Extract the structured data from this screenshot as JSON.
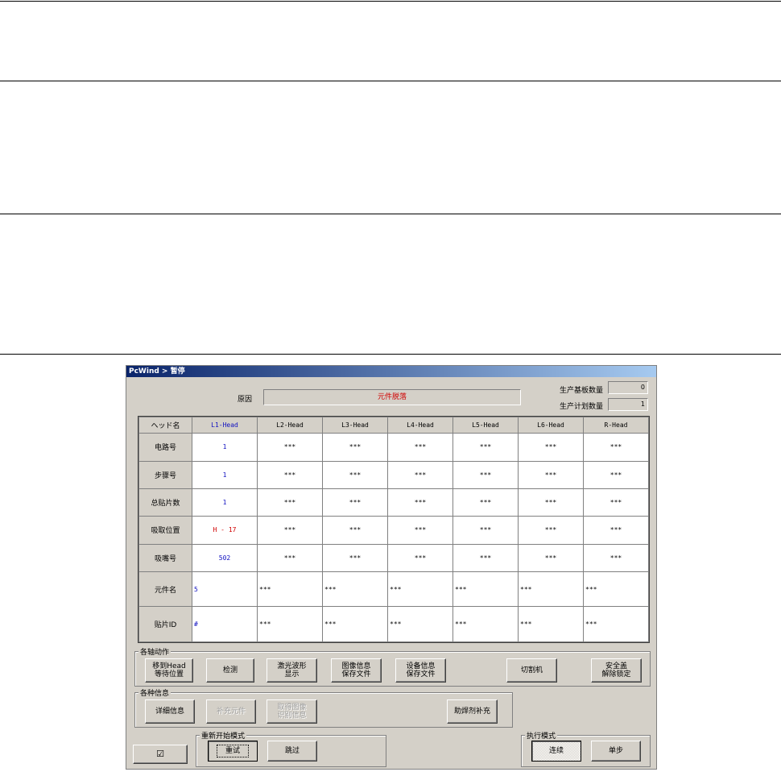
{
  "window": {
    "title": "PcWind > 暂停"
  },
  "cause": {
    "label": "原因",
    "value": "元件脱落"
  },
  "counters": {
    "produced_label": "生产基板数量",
    "produced_value": "0",
    "planned_label": "生产计划数量",
    "planned_value": "1"
  },
  "grid": {
    "header_label": "ヘッド名",
    "columns": [
      "L1-Head",
      "L2-Head",
      "L3-Head",
      "L4-Head",
      "L5-Head",
      "L6-Head",
      "R-Head"
    ],
    "rows": [
      {
        "label": "电路号",
        "values": [
          "1",
          "***",
          "***",
          "***",
          "***",
          "***",
          "***"
        ]
      },
      {
        "label": "步骤号",
        "values": [
          "1",
          "***",
          "***",
          "***",
          "***",
          "***",
          "***"
        ]
      },
      {
        "label": "总贴片数",
        "values": [
          "1",
          "***",
          "***",
          "***",
          "***",
          "***",
          "***"
        ]
      },
      {
        "label": "吸取位置",
        "values": [
          "H - 17",
          "***",
          "***",
          "***",
          "***",
          "***",
          "***"
        ]
      },
      {
        "label": "吸嘴号",
        "values": [
          "502",
          "***",
          "***",
          "***",
          "***",
          "***",
          "***"
        ]
      },
      {
        "label": "元件名",
        "values": [
          "5",
          "***",
          "***",
          "***",
          "***",
          "***",
          "***"
        ]
      },
      {
        "label": "贴片ID",
        "values": [
          "#",
          "***",
          "***",
          "***",
          "***",
          "***",
          "***"
        ]
      }
    ]
  },
  "actions": {
    "group_label": "各轴动作",
    "move_head": "移到Head\n等待位置",
    "inspect": "检测",
    "laser_wave": "激光波形\n显示",
    "save_image": "图像信息\n保存文件",
    "save_device": "设备信息\n保存文件",
    "cutter": "切割机",
    "release_safety": "安全盖\n解除锁定"
  },
  "info": {
    "group_label": "各种信息",
    "detail": "详细信息",
    "supplement": "补充元件",
    "pickup_image": "取得图像\n识别信息",
    "solder_supplement": "助焊剂补充"
  },
  "restart": {
    "group_label": "重新开始模式",
    "retry": "重试",
    "skip": "跳过"
  },
  "exec": {
    "group_label": "执行模式",
    "continuous": "连续",
    "single_step": "单步"
  },
  "checkbox": {
    "symbol": "☑"
  }
}
